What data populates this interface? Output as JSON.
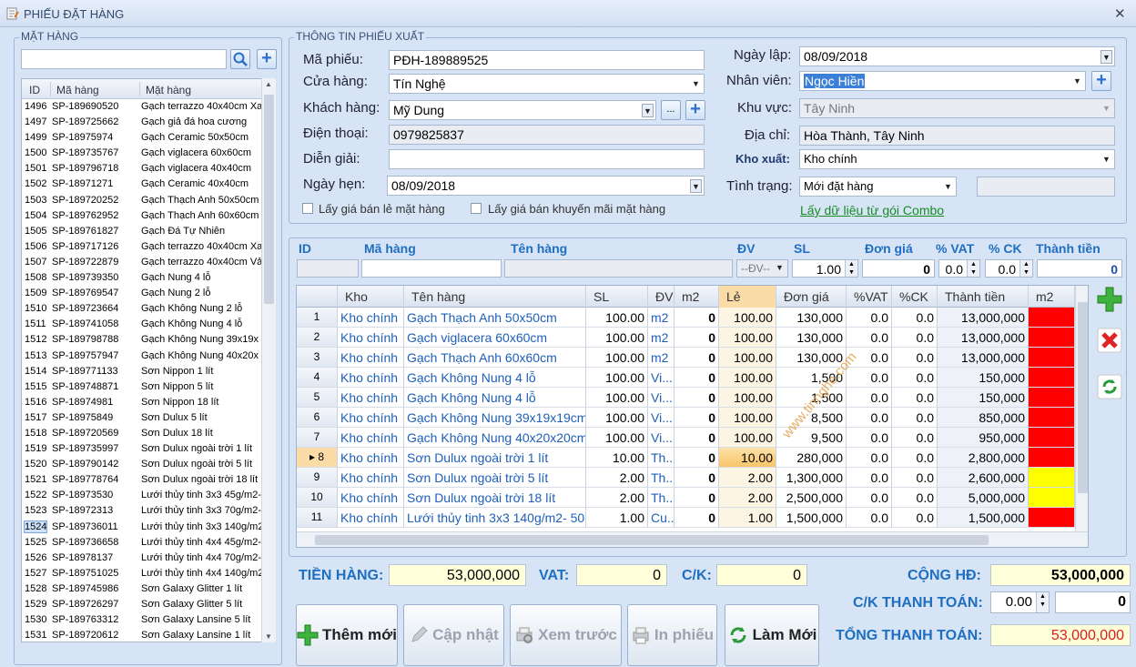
{
  "window": {
    "title": "PHIẾU ĐẶT HÀNG"
  },
  "left": {
    "group": "MẶT HÀNG",
    "cols": [
      "ID",
      "Mã hàng",
      "Mặt hàng"
    ],
    "items": [
      [
        "1496",
        "SP-189690520",
        "Gạch terrazzo 40x40cm Xa"
      ],
      [
        "1497",
        "SP-189725662",
        "Gạch giả đá hoa cương"
      ],
      [
        "1499",
        "SP-18975974",
        "Gạch  Ceramic 50x50cm"
      ],
      [
        "1500",
        "SP-189735767",
        "Gạch  viglacera 60x60cm"
      ],
      [
        "1501",
        "SP-189796718",
        "Gạch  viglacera  40x40cm"
      ],
      [
        "1502",
        "SP-18971271",
        "Gạch  Ceramic 40x40cm"
      ],
      [
        "1503",
        "SP-189720252",
        "Gạch  Thạch Anh 50x50cm"
      ],
      [
        "1504",
        "SP-189762952",
        "Gạch  Thạch Anh 60x60cm"
      ],
      [
        "1505",
        "SP-189761827",
        "Gạch Đá Tự Nhiên"
      ],
      [
        "1506",
        "SP-189717126",
        "Gạch terrazzo 40x40cm Xa"
      ],
      [
        "1507",
        "SP-189722879",
        "Gạch terrazzo 40x40cm Vả"
      ],
      [
        "1508",
        "SP-189739350",
        "Gạch Nung 4 lỗ"
      ],
      [
        "1509",
        "SP-189769547",
        "Gạch Nung 2 lỗ"
      ],
      [
        "1510",
        "SP-189723664",
        "Gạch Không Nung 2 lỗ"
      ],
      [
        "1511",
        "SP-189741058",
        "Gạch Không Nung 4 lỗ"
      ],
      [
        "1512",
        "SP-189798788",
        "Gạch Không Nung 39x19x"
      ],
      [
        "1513",
        "SP-189757947",
        "Gạch Không Nung 40x20x"
      ],
      [
        "1514",
        "SP-189771133",
        "Sơn Nippon 1 lít"
      ],
      [
        "1515",
        "SP-189748871",
        "Sơn Nippon 5 lít"
      ],
      [
        "1516",
        "SP-18974981",
        "Sơn Nippon 18 lít"
      ],
      [
        "1517",
        "SP-18975849",
        "Sơn Dulux 5 lít"
      ],
      [
        "1518",
        "SP-189720569",
        "Sơn Dulux 18 lít"
      ],
      [
        "1519",
        "SP-189735997",
        "Sơn Dulux ngoài trời 1 lít"
      ],
      [
        "1520",
        "SP-189790142",
        "Sơn Dulux ngoài trời 5 lít"
      ],
      [
        "1521",
        "SP-189778764",
        "Sơn Dulux ngoài trời 18 lít"
      ],
      [
        "1522",
        "SP-18973530",
        "Lưới thủy tinh 3x3 45g/m2-"
      ],
      [
        "1523",
        "SP-18972313",
        "Lưới thủy tinh 3x3 70g/m2-"
      ],
      [
        "1524",
        "SP-189736011",
        "Lưới thủy tinh 3x3 140g/m2"
      ],
      [
        "1525",
        "SP-189736658",
        "Lưới thủy tinh 4x4 45g/m2-"
      ],
      [
        "1526",
        "SP-18978137",
        "Lưới thủy tinh 4x4 70g/m2-"
      ],
      [
        "1527",
        "SP-189751025",
        "Lưới thủy tinh 4x4 140g/m2"
      ],
      [
        "1528",
        "SP-189745986",
        "Sơn Galaxy Glitter 1 lít"
      ],
      [
        "1529",
        "SP-189726297",
        "Sơn Galaxy Glitter 5 lít"
      ],
      [
        "1530",
        "SP-189763312",
        "Sơn Galaxy Lansine 5 lít"
      ],
      [
        "1531",
        "SP-189720612",
        "Sơn Galaxy Lansine 1 lít"
      ]
    ]
  },
  "info": {
    "group": "THÔNG TIN PHIẾU XUẤT",
    "ma_phieu_l": "Mã phiếu:",
    "ma_phieu": "PĐH-189889525",
    "cua_hang_l": "Cửa hàng:",
    "cua_hang": "Tín Nghệ",
    "khach_hang_l": "Khách hàng:",
    "khach_hang": "Mỹ Dung",
    "dots": "...",
    "dien_thoai_l": "Điện thoại:",
    "dien_thoai": "0979825837",
    "dien_giai_l": "Diễn giải:",
    "ngay_hen_l": "Ngày hẹn:",
    "ngay_hen": "08/09/2018",
    "chk1": "Lấy giá bán lẻ mặt hàng",
    "chk2": "Lấy giá bán khuyến mãi mặt hàng",
    "ngay_lap_l": "Ngày lập:",
    "ngay_lap": "08/09/2018",
    "nhan_vien_l": "Nhân viên:",
    "nhan_vien": "Ngọc Hiền",
    "khu_vuc_l": "Khu vực:",
    "khu_vuc": "Tây Ninh",
    "dia_chi_l": "Địa chỉ:",
    "dia_chi": "Hòa Thành, Tây Ninh",
    "kho_xuat_l": "Kho xuất:",
    "kho_xuat": "Kho chính",
    "tinh_trang_l": "Tình trạng:",
    "tinh_trang": "Mới đặt hàng",
    "combo": "Lấy dữ liệu từ gói Combo"
  },
  "entry": {
    "labels": [
      "ID",
      "Mã hàng",
      "Tên hàng",
      "ĐV",
      "SL",
      "Đơn giá",
      "% VAT",
      "% CK",
      "Thành tiền"
    ],
    "dv": "--ĐV--",
    "sl": "1.00",
    "don_gia": "0",
    "vat": "0.0",
    "ck": "0.0",
    "thanh_tien": "0"
  },
  "grid": {
    "cols": [
      "Kho",
      "Tên hàng",
      "SL",
      "ĐV",
      "m2",
      "Lẻ",
      "Đơn giá",
      "%VAT",
      "%CK",
      "Thành tiền",
      "m2"
    ],
    "rows": [
      [
        "1",
        "Kho chính",
        "Gạch  Thạch Anh 50x50cm",
        "100.00",
        "m2",
        "0",
        "100.00",
        "130,000",
        "0.0",
        "0.0",
        "13,000,000",
        "#ff0000"
      ],
      [
        "2",
        "Kho chính",
        "Gạch  viglacera 60x60cm",
        "100.00",
        "m2",
        "0",
        "100.00",
        "130,000",
        "0.0",
        "0.0",
        "13,000,000",
        "#ff0000"
      ],
      [
        "3",
        "Kho chính",
        "Gạch  Thạch Anh 60x60cm",
        "100.00",
        "m2",
        "0",
        "100.00",
        "130,000",
        "0.0",
        "0.0",
        "13,000,000",
        "#ff0000"
      ],
      [
        "4",
        "Kho chính",
        "Gạch Không Nung 4 lỗ",
        "100.00",
        "Vi...",
        "0",
        "100.00",
        "1,500",
        "0.0",
        "0.0",
        "150,000",
        "#ff0000"
      ],
      [
        "5",
        "Kho chính",
        "Gạch Không Nung 4 lỗ",
        "100.00",
        "Vi...",
        "0",
        "100.00",
        "1,500",
        "0.0",
        "0.0",
        "150,000",
        "#ff0000"
      ],
      [
        "6",
        "Kho chính",
        "Gạch Không Nung 39x19x19cm",
        "100.00",
        "Vi...",
        "0",
        "100.00",
        "8,500",
        "0.0",
        "0.0",
        "850,000",
        "#ff0000"
      ],
      [
        "7",
        "Kho chính",
        "Gạch Không Nung 40x20x20cm",
        "100.00",
        "Vi...",
        "0",
        "100.00",
        "9,500",
        "0.0",
        "0.0",
        "950,000",
        "#ff0000"
      ],
      [
        "8",
        "Kho chính",
        "Sơn Dulux ngoài trời 1 lít",
        "10.00",
        "Th...",
        "0",
        "10.00",
        "280,000",
        "0.0",
        "0.0",
        "2,800,000",
        "#ff0000"
      ],
      [
        "9",
        "Kho chính",
        "Sơn Dulux ngoài trời 5 lít",
        "2.00",
        "Th...",
        "0",
        "2.00",
        "1,300,000",
        "0.0",
        "0.0",
        "2,600,000",
        "#ffff00"
      ],
      [
        "10",
        "Kho chính",
        "Sơn Dulux ngoài trời 18 lít",
        "2.00",
        "Th...",
        "0",
        "2.00",
        "2,500,000",
        "0.0",
        "0.0",
        "5,000,000",
        "#ffff00"
      ],
      [
        "11",
        "Kho chính",
        "Lưới thủy tinh 3x3 140g/m2- 50m/",
        "1.00",
        "Cu...",
        "0",
        "1.00",
        "1,500,000",
        "0.0",
        "0.0",
        "1,500,000",
        "#ff0000"
      ]
    ],
    "watermark": "www.tinnghe.com"
  },
  "totals": {
    "tien_hang_l": "TIỀN HÀNG:",
    "tien_hang": "53,000,000",
    "vat_l": "VAT:",
    "vat": "0",
    "ck_l": "C/K:",
    "ck": "0",
    "cong_hd_l": "CỘNG HĐ:",
    "cong_hd": "53,000,000",
    "ck_tt_l": "C/K THANH TOÁN:",
    "ck_tt_pct": "0.00",
    "ck_tt": "0",
    "tong_l": "TỔNG THANH TOÁN:",
    "tong": "53,000,000"
  },
  "buttons": {
    "them": "Thêm mới",
    "cap_nhat": "Cập nhật",
    "xem": "Xem trước",
    "in": "In phiếu",
    "lam_moi": "Làm Mới"
  }
}
